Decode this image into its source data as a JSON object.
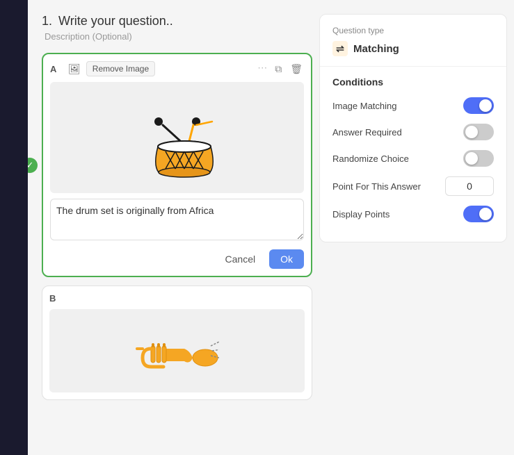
{
  "sidebar": {
    "background": "#1a1a2e"
  },
  "page": {
    "step_number": "1.",
    "step_title": "Write your question..",
    "description_label": "Description (Optional)"
  },
  "card_a": {
    "label": "A",
    "remove_image_label": "Remove Image",
    "answer_text": "The drum set is originally from Africa",
    "cancel_label": "Cancel",
    "ok_label": "Ok"
  },
  "card_b": {
    "label": "B"
  },
  "right_panel": {
    "question_type_label": "Question type",
    "question_type_value": "Matching",
    "conditions_title": "Conditions",
    "image_matching_label": "Image Matching",
    "image_matching_on": true,
    "answer_required_label": "Answer Required",
    "answer_required_on": false,
    "randomize_choice_label": "Randomize Choice",
    "randomize_choice_on": false,
    "point_label": "Point For This Answer",
    "point_value": "0",
    "display_points_label": "Display Points",
    "display_points_on": true
  }
}
